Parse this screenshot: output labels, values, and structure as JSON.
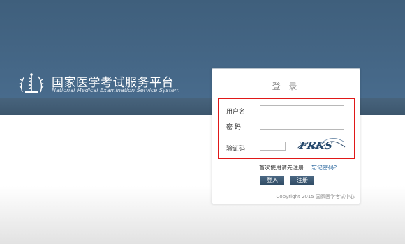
{
  "header": {
    "title": "国家医学考试服务平台",
    "subtitle": "National Medical Examination Service System",
    "logo_icon": "medical-caduceus-emblem"
  },
  "login": {
    "title": "登 录",
    "username_label": "用户名",
    "username_value": "",
    "password_label": "密 码",
    "password_value": "",
    "captcha_label": "验证码",
    "captcha_value": "",
    "captcha_text": "FRKS",
    "register_hint": "首次使用请先注册",
    "forgot_link": "忘记密码？",
    "login_button": "登入",
    "register_button": "注册",
    "copyright": "Copyright 2015 国家医学考试中心"
  },
  "colors": {
    "banner": "#436684",
    "highlight": "#e01818",
    "button": "#3f5a74",
    "link": "#1f5f99"
  }
}
